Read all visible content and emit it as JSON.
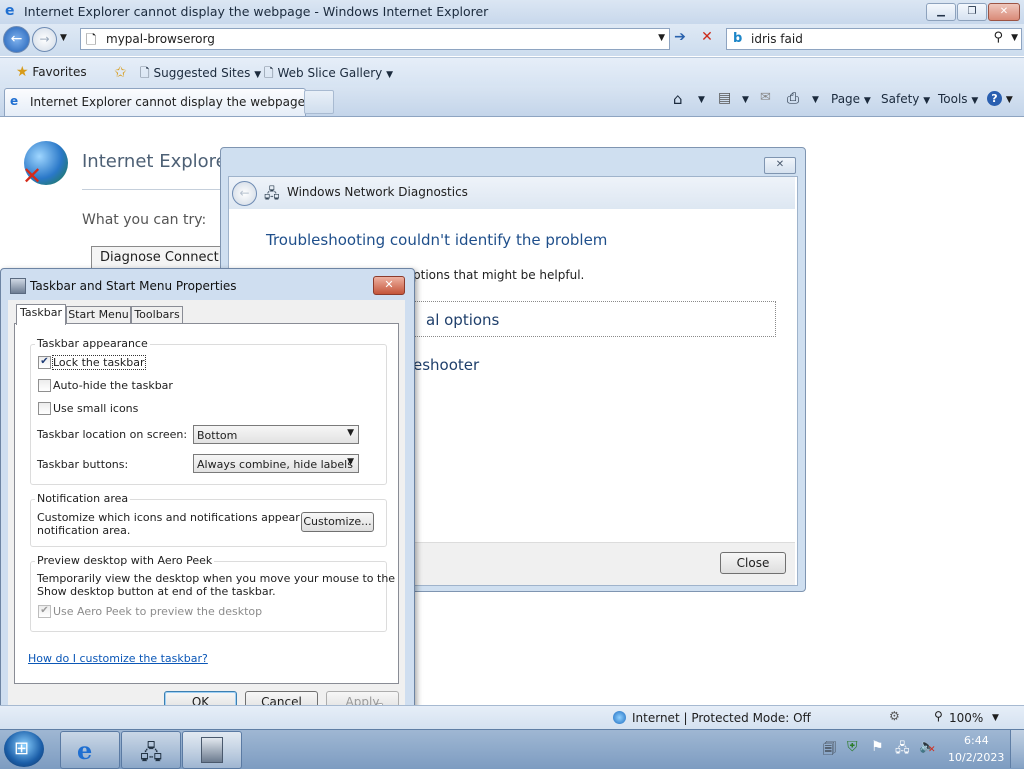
{
  "ie": {
    "title": "Internet Explorer cannot display the webpage - Windows Internet Explorer",
    "address": "mypal-browserorg",
    "search": "idris faid",
    "favorites": "Favorites",
    "suggested_sites": "Suggested Sites",
    "web_slice_gallery": "Web Slice Gallery",
    "tab_title": "Internet Explorer cannot display the webpage",
    "cmd_page": "Page",
    "cmd_safety": "Safety",
    "cmd_tools": "Tools",
    "page_heading": "Internet Explorer c",
    "what_you_can_try": "What you can try:",
    "diagnose_button": "Diagnose Connection"
  },
  "diagnostics": {
    "title": "Windows Network Diagnostics",
    "heading": "Troubleshooting couldn't identify the problem",
    "info_partial": "ptions that might be helpful.",
    "option1_partial": "al options",
    "option2_partial": "eshooter",
    "close_label": "Close"
  },
  "taskbar_props": {
    "title": "Taskbar and Start Menu Properties",
    "tabs": [
      "Taskbar",
      "Start Menu",
      "Toolbars"
    ],
    "appearance_legend": "Taskbar appearance",
    "lock_label": "Lock the taskbar",
    "autohide_label": "Auto-hide the taskbar",
    "small_icons_label": "Use small icons",
    "location_label": "Taskbar location on screen:",
    "location_value": "Bottom",
    "buttons_label": "Taskbar buttons:",
    "buttons_value": "Always combine, hide labels",
    "notification_legend": "Notification area",
    "notification_text_1": "Customize which icons and notifications appear in the",
    "notification_text_2": "notification area.",
    "customize_label": "Customize...",
    "aero_legend": "Preview desktop with Aero Peek",
    "aero_text_1": "Temporarily view the desktop when you move your mouse to the",
    "aero_text_2": "Show desktop button at end of the taskbar.",
    "aero_checkbox_label": "Use Aero Peek to preview the desktop",
    "help_link": "How do I customize the taskbar?",
    "ok_label": "OK",
    "cancel_label": "Cancel",
    "apply_label": "Apply"
  },
  "statusbar": {
    "zone": "Internet | Protected Mode: Off",
    "zoom": "100%"
  },
  "clock": {
    "time": "6:44",
    "date": "10/2/2023"
  },
  "colors": {
    "link": "#0b57b7",
    "heading_blue": "#1f4f8b"
  }
}
